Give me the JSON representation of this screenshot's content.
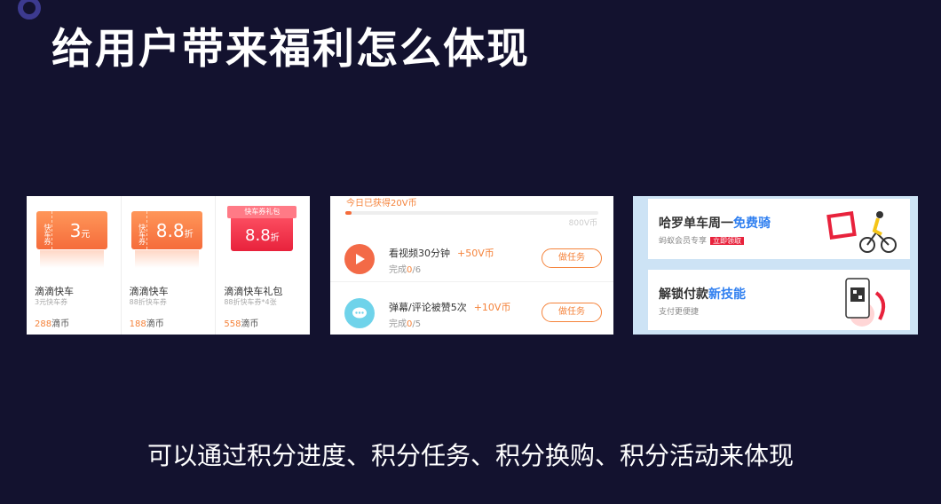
{
  "page": {
    "title": "给用户带来福利怎么体现",
    "subtitle": "可以通过积分进度、积分任务、积分换购、积分活动来体现"
  },
  "coupons": [
    {
      "tag": "快车券",
      "value": "3",
      "unit": "元",
      "name": "滴滴快车",
      "desc": "3元快车券",
      "price": "288",
      "currency": "滴币"
    },
    {
      "tag": "快车券",
      "value": "8.8",
      "unit": "折",
      "name": "滴滴快车",
      "desc": "88折快车券",
      "price": "188",
      "currency": "滴币"
    },
    {
      "tag": "快车券礼包",
      "value": "8.8",
      "unit": "折",
      "name": "滴滴快车礼包",
      "desc": "88折快车券*4张",
      "price": "558",
      "currency": "滴币"
    }
  ],
  "tasks_panel": {
    "earned": "今日已获得20V币",
    "progress_max": "800V币",
    "progress_fraction": 0.025,
    "tasks": [
      {
        "title": "看视频30分钟",
        "reward": "+50V币",
        "progress_label": "完成",
        "done": "0",
        "total": "/6",
        "button": "做任务",
        "icon": "play-icon"
      },
      {
        "title": "弹幕/评论被赞5次",
        "reward": "+10V币",
        "progress_label": "完成",
        "done": "0",
        "total": "/5",
        "button": "做任务",
        "icon": "chat-icon"
      }
    ]
  },
  "bike_panel": {
    "promo1": {
      "title": "哈罗单车周一",
      "highlight": "免费骑",
      "sub": "蚂蚁会员专享",
      "badge": "立即领取"
    },
    "promo2": {
      "title": "解锁付款",
      "highlight": "新技能",
      "sub": "支付更便捷"
    }
  },
  "colors": {
    "background": "#13122f",
    "accent_orange": "#f5833b",
    "accent_blue": "#2f7ff0",
    "accent_red": "#e8223c"
  }
}
